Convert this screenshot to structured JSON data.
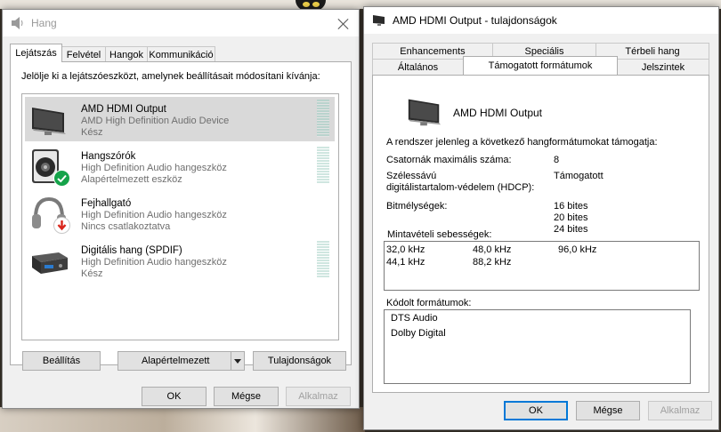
{
  "left_window": {
    "title": "Hang",
    "tabs": [
      "Lejátszás",
      "Felvétel",
      "Hangok",
      "Kommunikáció"
    ],
    "instruction": "Jelölje ki a lejátszóeszközt, amelynek beállításait módosítani kívánja:",
    "devices": [
      {
        "name": "AMD HDMI Output",
        "line1": "AMD High Definition Audio Device",
        "line2": "Kész",
        "icon": "monitor-icon",
        "selected": true
      },
      {
        "name": "Hangszórók",
        "line1": "High Definition Audio hangeszköz",
        "line2": "Alapértelmezett eszköz",
        "icon": "speaker-icon",
        "badge": "default-check-icon"
      },
      {
        "name": "Fejhallgató",
        "line1": "High Definition Audio hangeszköz",
        "line2": "Nincs csatlakoztatva",
        "icon": "headphones-icon",
        "badge": "unplugged-arrow-icon"
      },
      {
        "name": "Digitális hang (SPDIF)",
        "line1": "High Definition Audio hangeszköz",
        "line2": "Kész",
        "icon": "spdif-receiver-icon"
      }
    ],
    "buttons": {
      "configure": "Beállítás",
      "set_default": "Alapértelmezett",
      "properties": "Tulajdonságok",
      "ok": "OK",
      "cancel": "Mégse",
      "apply": "Alkalmaz"
    }
  },
  "right_window": {
    "title": "AMD HDMI Output - tulajdonságok",
    "tabs_row1": [
      "Enhancements",
      "Speciális",
      "Térbeli hang"
    ],
    "tabs_row2": [
      "Általános",
      "Támogatott formátumok",
      "Jelszintek"
    ],
    "device_name": "AMD HDMI Output",
    "intro": "A rendszer jelenleg a következő hangformátumokat támogatja:",
    "max_channels_label": "Csatornák maximális száma:",
    "max_channels_value": "8",
    "hdcp_label_1": "Szélessávú",
    "hdcp_label_2": "digitálistartalom-védelem (HDCP):",
    "hdcp_value": "Támogatott",
    "bit_depth_label": "Bitmélységek:",
    "bit_depths": [
      "16 bites",
      "20 bites",
      "24 bites"
    ],
    "sample_rates_label": "Mintavételi sebességek:",
    "sample_rates": [
      "32,0 kHz",
      "48,0 kHz",
      "96,0 kHz",
      "44,1 kHz",
      "88,2 kHz"
    ],
    "encoded_label": "Kódolt formátumok:",
    "encoded_formats": [
      "DTS Audio",
      "Dolby Digital"
    ],
    "buttons": {
      "ok": "OK",
      "cancel": "Mégse",
      "apply": "Alkalmaz"
    }
  }
}
